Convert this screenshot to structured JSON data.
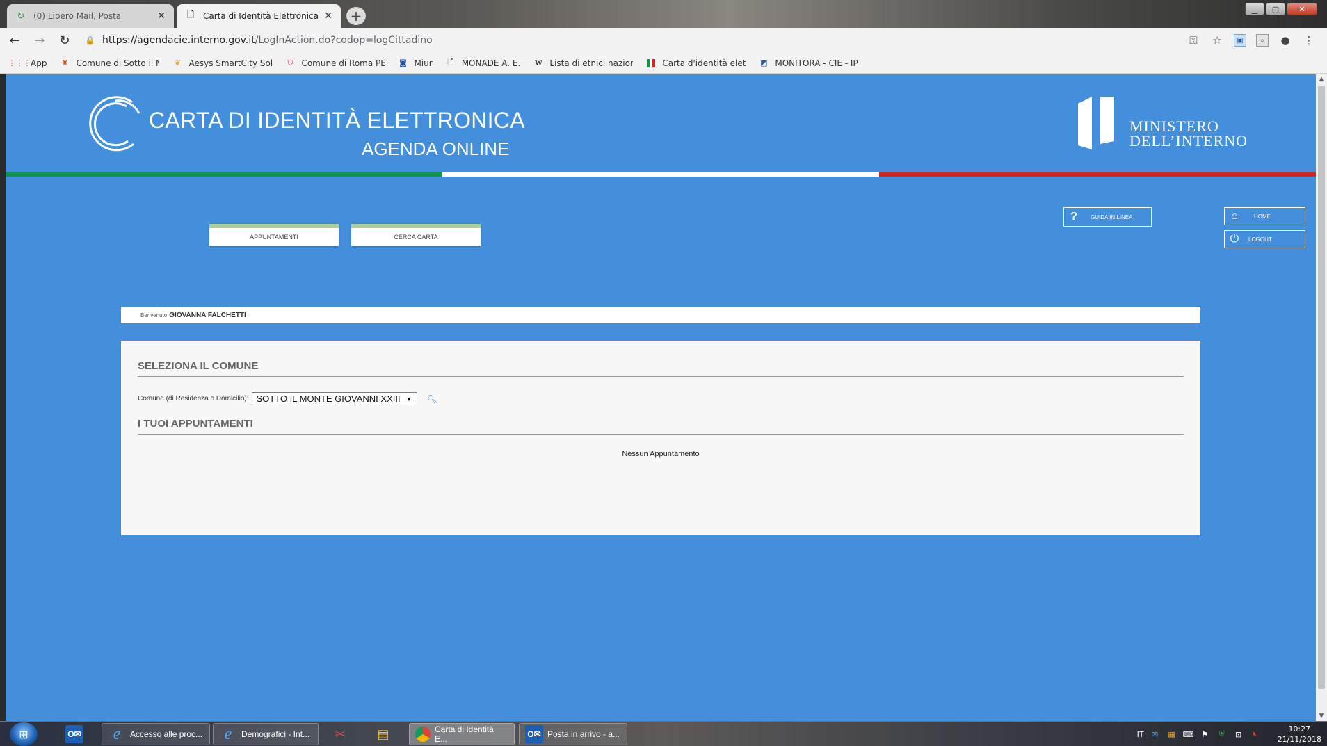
{
  "browser": {
    "tabs": [
      {
        "title": "(0) Libero Mail, Posta",
        "close": "✕"
      },
      {
        "title": "Carta di Identità Elettronica (inde",
        "close": "✕"
      }
    ],
    "new_tab": "+",
    "window_controls": {
      "minimize": "▁",
      "maximize": "▢",
      "close": "✕"
    },
    "url_host": "https://agendacie.interno.gov.it",
    "url_path": "/LogInAction.do?codop=logCittadino",
    "bookmarks": [
      {
        "label": "App"
      },
      {
        "label": "Comune di Sotto il M"
      },
      {
        "label": "Aesys SmartCity Solu"
      },
      {
        "label": "Comune di Roma PE"
      },
      {
        "label": "Miur"
      },
      {
        "label": "MONADE A. E."
      },
      {
        "label": "Lista di etnici naziona"
      },
      {
        "label": "Carta d'identità elett"
      },
      {
        "label": "MONITORA - CIE - IP"
      }
    ]
  },
  "site": {
    "title": "CARTA DI IDENTITÀ ELETTRONICA",
    "subtitle": "AGENDA ONLINE",
    "ministero_line1": "MINISTERO",
    "ministero_line2": "DELL’INTERNO",
    "colors": {
      "background": "#438fdc",
      "green": "#109447",
      "white": "#ffffff",
      "red": "#d8231e"
    }
  },
  "nav": {
    "appuntamenti": "APPUNTAMENTI",
    "cerca_carta": "CERCA CARTA",
    "guida": "GUIDA IN LINEA",
    "home": "HOME",
    "logout": "LOGOUT"
  },
  "welcome": {
    "label": "Benvenuto",
    "user": "GIOVANNA FALCHETTI"
  },
  "panel": {
    "seleziona_title": "SELEZIONA IL COMUNE",
    "comune_label": "Comune (di Residenza o Domicilio):",
    "comune_value": "SOTTO IL MONTE GIOVANNI XXIII",
    "appuntamenti_title": "I TUOI APPUNTAMENTI",
    "empty_message": "Nessun Appuntamento"
  },
  "taskbar": {
    "items": [
      {
        "label": ""
      },
      {
        "label": "Accesso alle proc..."
      },
      {
        "label": "Demografici - Int..."
      },
      {
        "label": ""
      },
      {
        "label": ""
      },
      {
        "label": "Carta di Identità E..."
      },
      {
        "label": "Posta in arrivo - a..."
      }
    ],
    "language": "IT",
    "time": "10:27",
    "date": "21/11/2018"
  }
}
